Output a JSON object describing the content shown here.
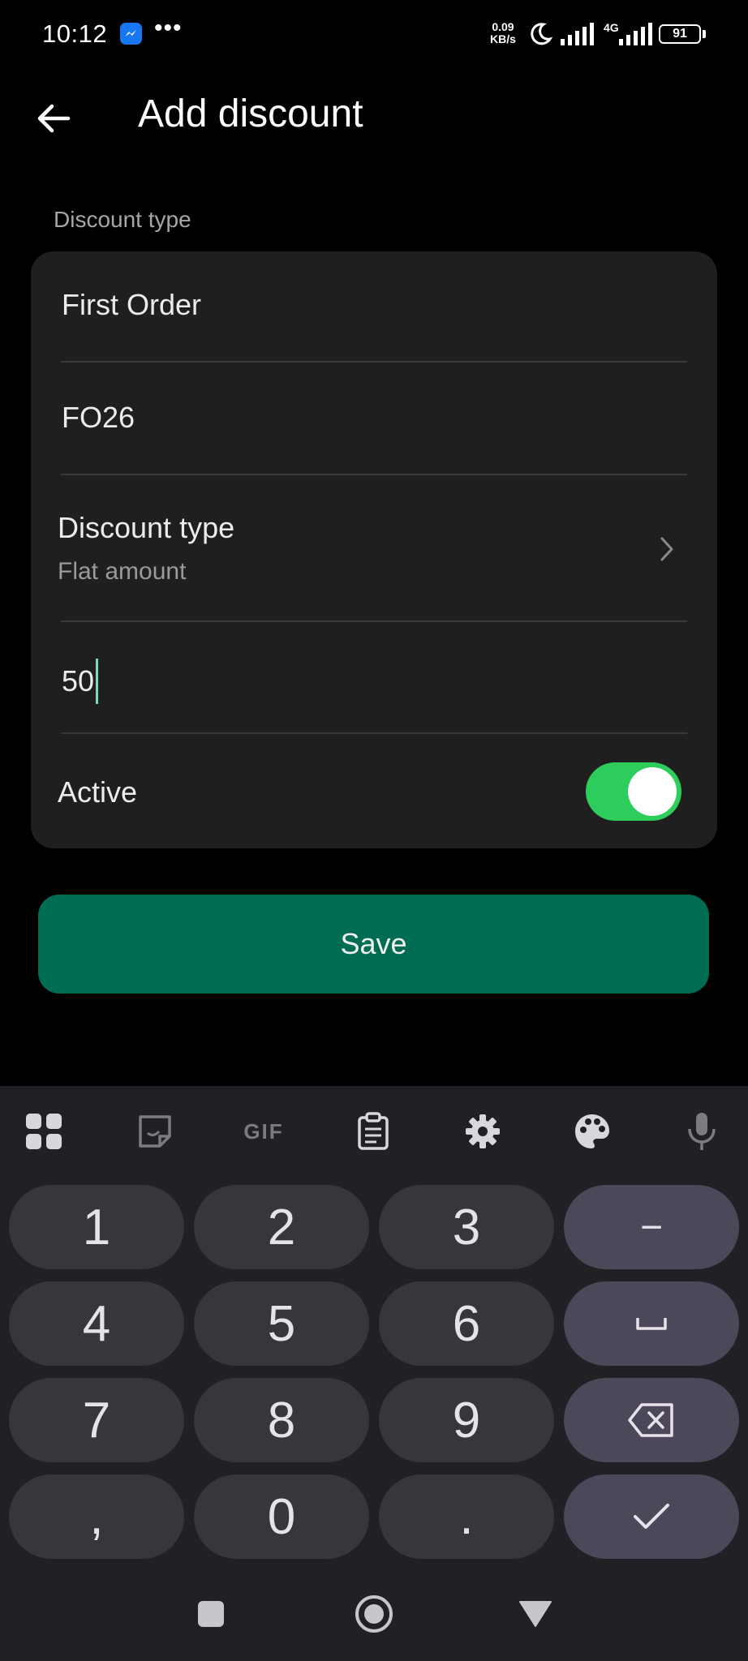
{
  "status_bar": {
    "time": "10:12",
    "more_indicator": "•••",
    "net_speed_value": "0.09",
    "net_speed_unit": "KB/s",
    "network_type": "4G",
    "battery": "91"
  },
  "app_bar": {
    "title": "Add discount",
    "back_icon": "arrow-left-icon"
  },
  "form": {
    "section_label": "Discount type",
    "name_value": "First Order",
    "code_value": "FO26",
    "discount_type_title": "Discount type",
    "discount_type_value": "Flat amount",
    "amount_value": "50",
    "active_label": "Active",
    "active_on": true,
    "save_label": "Save"
  },
  "colors": {
    "background": "#000000",
    "card": "#1f1f1f",
    "toggle_on": "#2ecc5a",
    "save_button": "#006d52",
    "keyboard": "#212025",
    "key": "#38363d",
    "function_key": "#4c4759"
  },
  "keyboard": {
    "toolbar": [
      "apps-grid-icon",
      "sticker-icon",
      "gif-icon",
      "clipboard-icon",
      "settings-gear-icon",
      "palette-icon",
      "microphone-icon"
    ],
    "gif_label": "GIF",
    "keys": {
      "k1": "1",
      "k2": "2",
      "k3": "3",
      "minus": "−",
      "k4": "4",
      "k5": "5",
      "k6": "6",
      "k7": "7",
      "k8": "8",
      "k9": "9",
      "comma": ",",
      "k0": "0",
      "period": "."
    },
    "function_icons": [
      "space-icon",
      "backspace-icon",
      "checkmark-icon"
    ]
  },
  "nav_bar": {
    "buttons": [
      "recents-square-icon",
      "home-circle-icon",
      "back-triangle-icon"
    ]
  }
}
